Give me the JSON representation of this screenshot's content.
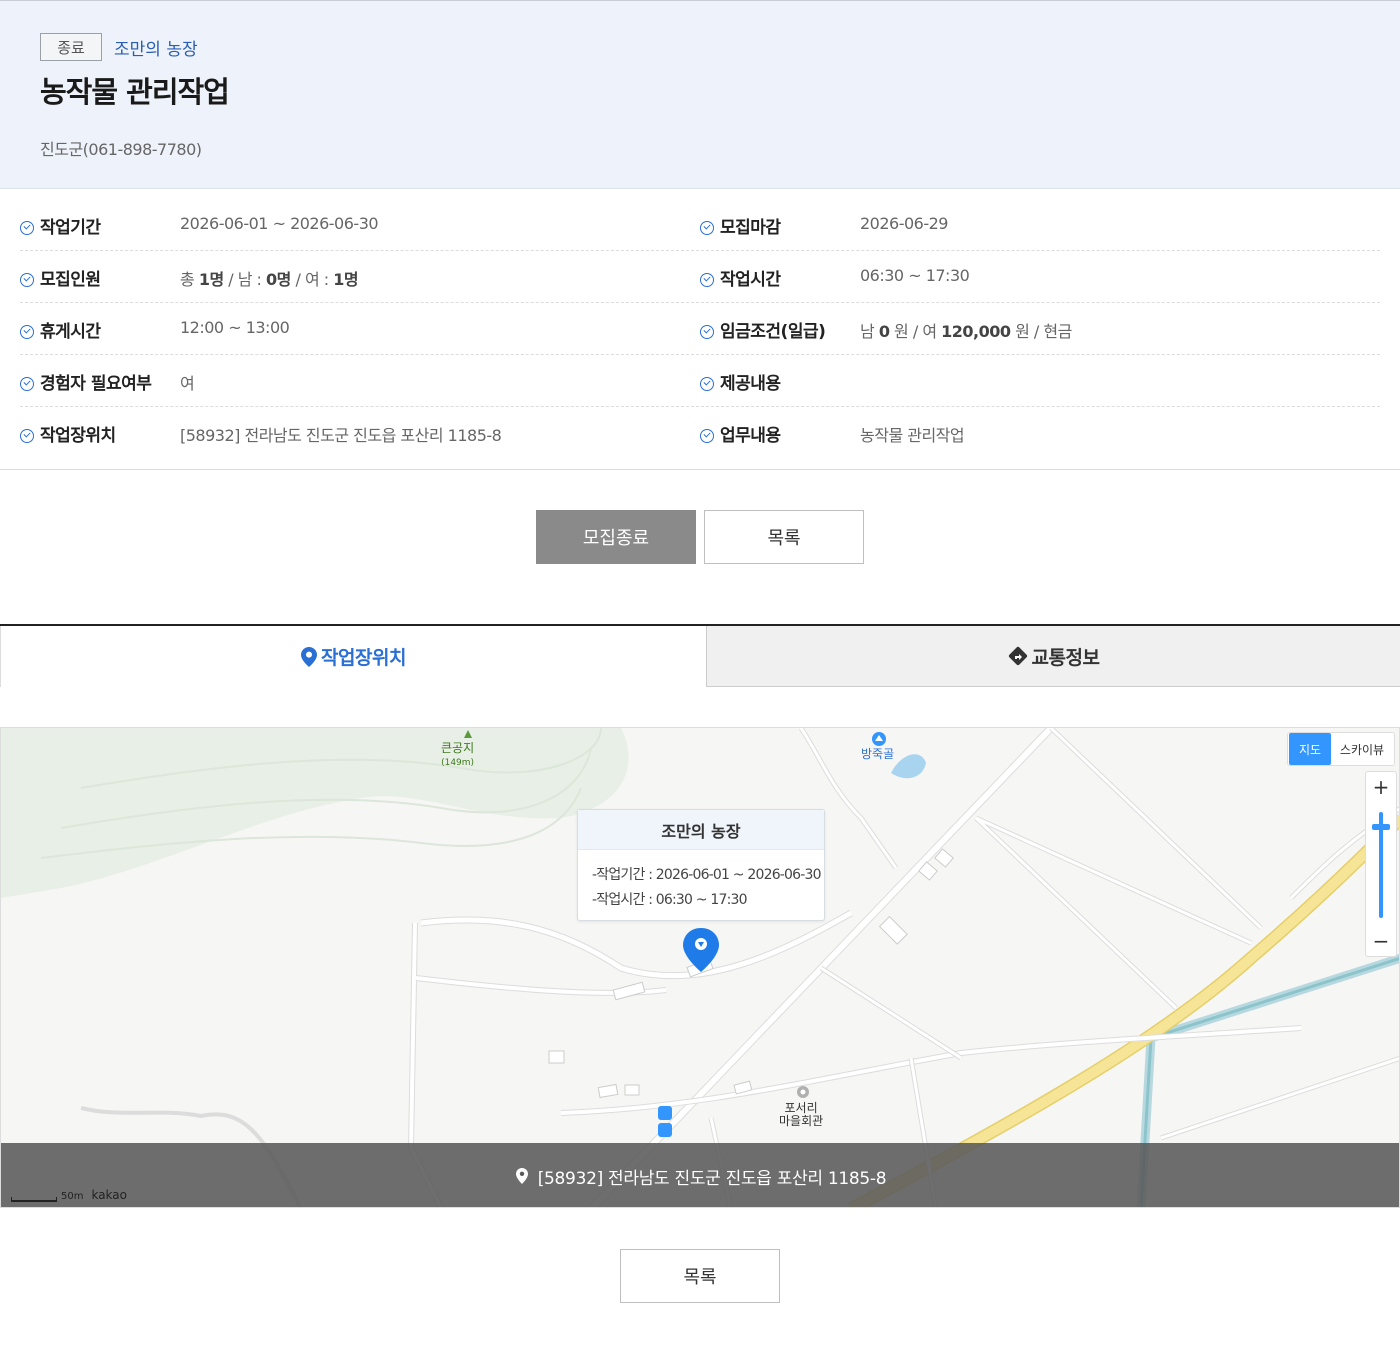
{
  "header": {
    "status_badge": "종료",
    "farm_name": "조만의 농장",
    "title": "농작물 관리작업",
    "contact": "진도군(061-898-7780)"
  },
  "info": {
    "work_period_label": "작업기간",
    "work_period_value": "2026-06-01 ~ 2026-06-30",
    "deadline_label": "모집마감",
    "deadline_value": "2026-06-29",
    "recruit_label": "모집인원",
    "recruit_total_prefix": "총 ",
    "recruit_total": "1명",
    "recruit_male_prefix": " / 남 : ",
    "recruit_male": "0명",
    "recruit_female_prefix": " / 여 : ",
    "recruit_female": "1명",
    "work_time_label": "작업시간",
    "work_time_value": "06:30 ~ 17:30",
    "break_label": "휴게시간",
    "break_value": "12:00 ~ 13:00",
    "wage_label": "임금조건(일급)",
    "wage_male_prefix": "남 ",
    "wage_male": "0",
    "wage_mid": " 원 / 여 ",
    "wage_female": "120,000",
    "wage_suffix": " 원 / 현금",
    "experience_label": "경험자 필요여부",
    "experience_value": "여",
    "provide_label": "제공내용",
    "provide_value": "",
    "location_label": "작업장위치",
    "location_value": "[58932] 전라남도 진도군 진도읍 포산리 1185-8",
    "duty_label": "업무내용",
    "duty_value": "농작물 관리작업"
  },
  "buttons": {
    "closed": "모집종료",
    "list": "목록"
  },
  "tabs": {
    "location": "작업장위치",
    "traffic": "교통정보"
  },
  "map": {
    "popup_title": "조만의 농장",
    "popup_period": "-작업기간 : 2026-06-01 ~ 2026-06-30",
    "popup_time": "-작업시간 : 06:30 ~ 17:30",
    "type_map": "지도",
    "type_sky": "스카이뷰",
    "zoom_in": "+",
    "zoom_out": "−",
    "address": "[58932] 전라남도 진도군 진도읍 포산리 1185-8",
    "scale": "50m",
    "brand": "kakao",
    "label_mountain": "큰공지",
    "label_mountain_height": "(149m)",
    "label_pond": "방죽골",
    "label_hall_1": "포서리",
    "label_hall_2": "마을회관"
  },
  "colors": {
    "accent": "#2a6fd4",
    "farm_link": "#2a5db0",
    "header_bg": "#eef3fb",
    "closed_button": "#8a8a8a",
    "map_button": "#3396ff",
    "road_major": "#f4e08a"
  }
}
